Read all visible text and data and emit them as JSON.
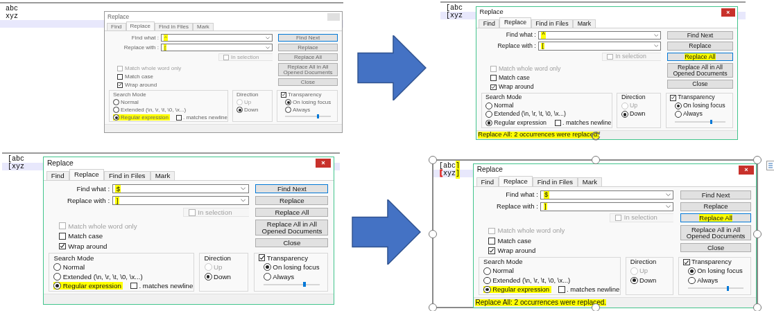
{
  "panels": [
    {
      "selected": false,
      "editor_lines": [
        {
          "current": false,
          "segments": [
            {
              "text": "abc",
              "highlighted": false
            }
          ]
        },
        {
          "current": false,
          "segments": [
            {
              "text": "xyz",
              "highlighted": false
            }
          ]
        },
        {
          "current": true
        }
      ],
      "dialog": {
        "title": "Replace",
        "inactive": true,
        "tabs": [
          {
            "label": "Find",
            "selected": false
          },
          {
            "label": "Replace",
            "selected": true
          },
          {
            "label": "Find in Files",
            "selected": false
          },
          {
            "label": "Mark",
            "selected": false
          }
        ],
        "find_label": "Find what :",
        "find_value": "^",
        "find_highlighted": true,
        "replace_label": "Replace with :",
        "replace_value": "[",
        "replace_highlighted": true,
        "in_selection": {
          "label": "In selection",
          "checked": false,
          "disabled": true
        },
        "buttons": [
          {
            "label": "Find Next",
            "focused": true,
            "highlighted": false
          },
          {
            "label": "Replace",
            "focused": false,
            "highlighted": false
          },
          {
            "label": "Replace All",
            "focused": false,
            "highlighted": false
          },
          {
            "label": "Replace All in All Opened Documents",
            "focused": false,
            "highlighted": false
          },
          {
            "label": "Close",
            "focused": false,
            "highlighted": false
          }
        ],
        "options": [
          {
            "label": "Match whole word only",
            "checked": false,
            "disabled": true
          },
          {
            "label": "Match case",
            "checked": false,
            "disabled": false
          },
          {
            "label": "Wrap around",
            "checked": true,
            "disabled": false
          }
        ],
        "search_mode": {
          "title": "Search Mode",
          "options": [
            {
              "label": "Normal",
              "selected": false,
              "disabled": false,
              "highlighted": false
            },
            {
              "label": "Extended (\\n, \\r, \\t, \\0, \\x...)",
              "selected": false,
              "disabled": false,
              "highlighted": false
            },
            {
              "label": "Regular expression",
              "selected": true,
              "disabled": false,
              "highlighted": true
            }
          ],
          "newline": {
            "label": ". matches newline",
            "checked": false
          }
        },
        "direction": {
          "title": "Direction",
          "options": [
            {
              "label": "Up",
              "selected": false,
              "disabled": true
            },
            {
              "label": "Down",
              "selected": true,
              "disabled": false
            }
          ]
        },
        "transparency": {
          "label": "Transparency",
          "checked": true,
          "options": [
            {
              "label": "On losing focus",
              "selected": true
            },
            {
              "label": "Always",
              "selected": false
            }
          ],
          "level": 0.7
        }
      }
    },
    {
      "selected": false,
      "editor_lines": [
        {
          "current": false,
          "segments": [
            {
              "text": "[abc",
              "highlighted": false
            }
          ]
        },
        {
          "current": true,
          "segments": [
            {
              "text": "[xyz",
              "highlighted": false
            }
          ]
        }
      ],
      "dialog": {
        "title": "Replace",
        "inactive": false,
        "tabs": [
          {
            "label": "Find",
            "selected": false
          },
          {
            "label": "Replace",
            "selected": true
          },
          {
            "label": "Find in Files",
            "selected": false
          },
          {
            "label": "Mark",
            "selected": false
          }
        ],
        "find_label": "Find what :",
        "find_value": "^",
        "find_highlighted": true,
        "replace_label": "Replace with :",
        "replace_value": "[",
        "replace_highlighted": true,
        "in_selection": {
          "label": "In selection",
          "checked": false,
          "disabled": true
        },
        "buttons": [
          {
            "label": "Find Next",
            "focused": false,
            "highlighted": false
          },
          {
            "label": "Replace",
            "focused": false,
            "highlighted": false
          },
          {
            "label": "Replace All",
            "focused": true,
            "highlighted": true
          },
          {
            "label": "Replace All in All Opened Documents",
            "focused": false,
            "highlighted": false
          },
          {
            "label": "Close",
            "focused": false,
            "highlighted": false
          }
        ],
        "options": [
          {
            "label": "Match whole word only",
            "checked": false,
            "disabled": true
          },
          {
            "label": "Match case",
            "checked": false,
            "disabled": false
          },
          {
            "label": "Wrap around",
            "checked": true,
            "disabled": false
          }
        ],
        "search_mode": {
          "title": "Search Mode",
          "options": [
            {
              "label": "Normal",
              "selected": false,
              "disabled": false,
              "highlighted": false
            },
            {
              "label": "Extended (\\n, \\r, \\t, \\0, \\x...)",
              "selected": false,
              "disabled": false,
              "highlighted": false
            },
            {
              "label": "Regular expression",
              "selected": true,
              "disabled": false,
              "highlighted": false
            }
          ],
          "newline": {
            "label": ". matches newline",
            "checked": false
          }
        },
        "direction": {
          "title": "Direction",
          "options": [
            {
              "label": "Up",
              "selected": false,
              "disabled": true
            },
            {
              "label": "Down",
              "selected": true,
              "disabled": false
            }
          ]
        },
        "transparency": {
          "label": "Transparency",
          "checked": true,
          "options": [
            {
              "label": "On losing focus",
              "selected": true
            },
            {
              "label": "Always",
              "selected": false
            }
          ],
          "level": 0.7
        },
        "status": {
          "text": "Replace All: 2 occurrences were replaced.",
          "highlighted": true
        }
      }
    },
    {
      "selected": false,
      "editor_lines": [
        {
          "current": false,
          "segments": [
            {
              "text": "[abc",
              "highlighted": false
            }
          ]
        },
        {
          "current": true,
          "segments": [
            {
              "text": "[xyz",
              "highlighted": false
            }
          ]
        }
      ],
      "dialog": {
        "title": "Replace",
        "inactive": false,
        "tabs": [
          {
            "label": "Find",
            "selected": false
          },
          {
            "label": "Replace",
            "selected": true
          },
          {
            "label": "Find in Files",
            "selected": false
          },
          {
            "label": "Mark",
            "selected": false
          }
        ],
        "find_label": "Find what :",
        "find_value": "$",
        "find_highlighted": true,
        "replace_label": "Replace with :",
        "replace_value": "]",
        "replace_highlighted": true,
        "in_selection": {
          "label": "In selection",
          "checked": false,
          "disabled": true
        },
        "buttons": [
          {
            "label": "Find Next",
            "focused": true,
            "highlighted": false
          },
          {
            "label": "Replace",
            "focused": false,
            "highlighted": false
          },
          {
            "label": "Replace All",
            "focused": false,
            "highlighted": false
          },
          {
            "label": "Replace All in All Opened Documents",
            "focused": false,
            "highlighted": false
          },
          {
            "label": "Close",
            "focused": false,
            "highlighted": false
          }
        ],
        "options": [
          {
            "label": "Match whole word only",
            "checked": false,
            "disabled": true
          },
          {
            "label": "Match case",
            "checked": false,
            "disabled": false
          },
          {
            "label": "Wrap around",
            "checked": true,
            "disabled": false
          }
        ],
        "search_mode": {
          "title": "Search Mode",
          "options": [
            {
              "label": "Normal",
              "selected": false,
              "disabled": false,
              "highlighted": false
            },
            {
              "label": "Extended (\\n, \\r, \\t, \\0, \\x...)",
              "selected": false,
              "disabled": false,
              "highlighted": false
            },
            {
              "label": "Regular expression",
              "selected": true,
              "disabled": false,
              "highlighted": true
            }
          ],
          "newline": {
            "label": ". matches newline",
            "checked": false
          }
        },
        "direction": {
          "title": "Direction",
          "options": [
            {
              "label": "Up",
              "selected": false,
              "disabled": true
            },
            {
              "label": "Down",
              "selected": true,
              "disabled": false
            }
          ]
        },
        "transparency": {
          "label": "Transparency",
          "checked": true,
          "options": [
            {
              "label": "On losing focus",
              "selected": true
            },
            {
              "label": "Always",
              "selected": false
            }
          ],
          "level": 0.7
        }
      }
    },
    {
      "selected": true,
      "editor_lines": [
        {
          "current": false,
          "segments": [
            {
              "text": "[abc",
              "highlighted": false
            },
            {
              "text": "]",
              "highlighted": true
            }
          ]
        },
        {
          "current": true,
          "segments": [
            {
              "text": "[",
              "highlighted": false,
              "color": "#e0201c"
            },
            {
              "text": "xyz",
              "highlighted": false
            },
            {
              "text": "]",
              "highlighted": true
            }
          ]
        }
      ],
      "dialog": {
        "title": "Replace",
        "inactive": false,
        "tabs": [
          {
            "label": "Find",
            "selected": false
          },
          {
            "label": "Replace",
            "selected": true
          },
          {
            "label": "Find in Files",
            "selected": false
          },
          {
            "label": "Mark",
            "selected": false
          }
        ],
        "find_label": "Find what :",
        "find_value": "$",
        "find_highlighted": true,
        "replace_label": "Replace with :",
        "replace_value": "]",
        "replace_highlighted": true,
        "in_selection": {
          "label": "In selection",
          "checked": false,
          "disabled": true
        },
        "buttons": [
          {
            "label": "Find Next",
            "focused": false,
            "highlighted": false
          },
          {
            "label": "Replace",
            "focused": false,
            "highlighted": false
          },
          {
            "label": "Replace All",
            "focused": true,
            "highlighted": true
          },
          {
            "label": "Replace All in All Opened Documents",
            "focused": false,
            "highlighted": false
          },
          {
            "label": "Close",
            "focused": false,
            "highlighted": false
          }
        ],
        "options": [
          {
            "label": "Match whole word only",
            "checked": false,
            "disabled": true
          },
          {
            "label": "Match case",
            "checked": false,
            "disabled": false
          },
          {
            "label": "Wrap around",
            "checked": true,
            "disabled": false
          }
        ],
        "search_mode": {
          "title": "Search Mode",
          "options": [
            {
              "label": "Normal",
              "selected": false,
              "disabled": false,
              "highlighted": false
            },
            {
              "label": "Extended (\\n, \\r, \\t, \\0, \\x...)",
              "selected": false,
              "disabled": false,
              "highlighted": false
            },
            {
              "label": "Regular expression",
              "selected": true,
              "disabled": false,
              "highlighted": true
            }
          ],
          "newline": {
            "label": ". matches newline",
            "checked": false
          }
        },
        "direction": {
          "title": "Direction",
          "options": [
            {
              "label": "Up",
              "selected": false,
              "disabled": true
            },
            {
              "label": "Down",
              "selected": true,
              "disabled": false
            }
          ]
        },
        "transparency": {
          "label": "Transparency",
          "checked": true,
          "options": [
            {
              "label": "On losing focus",
              "selected": true
            },
            {
              "label": "Always",
              "selected": false
            }
          ],
          "level": 0.7
        },
        "status": {
          "text": "Replace All: 2 occurrences were replaced.",
          "highlighted": true
        }
      }
    }
  ]
}
